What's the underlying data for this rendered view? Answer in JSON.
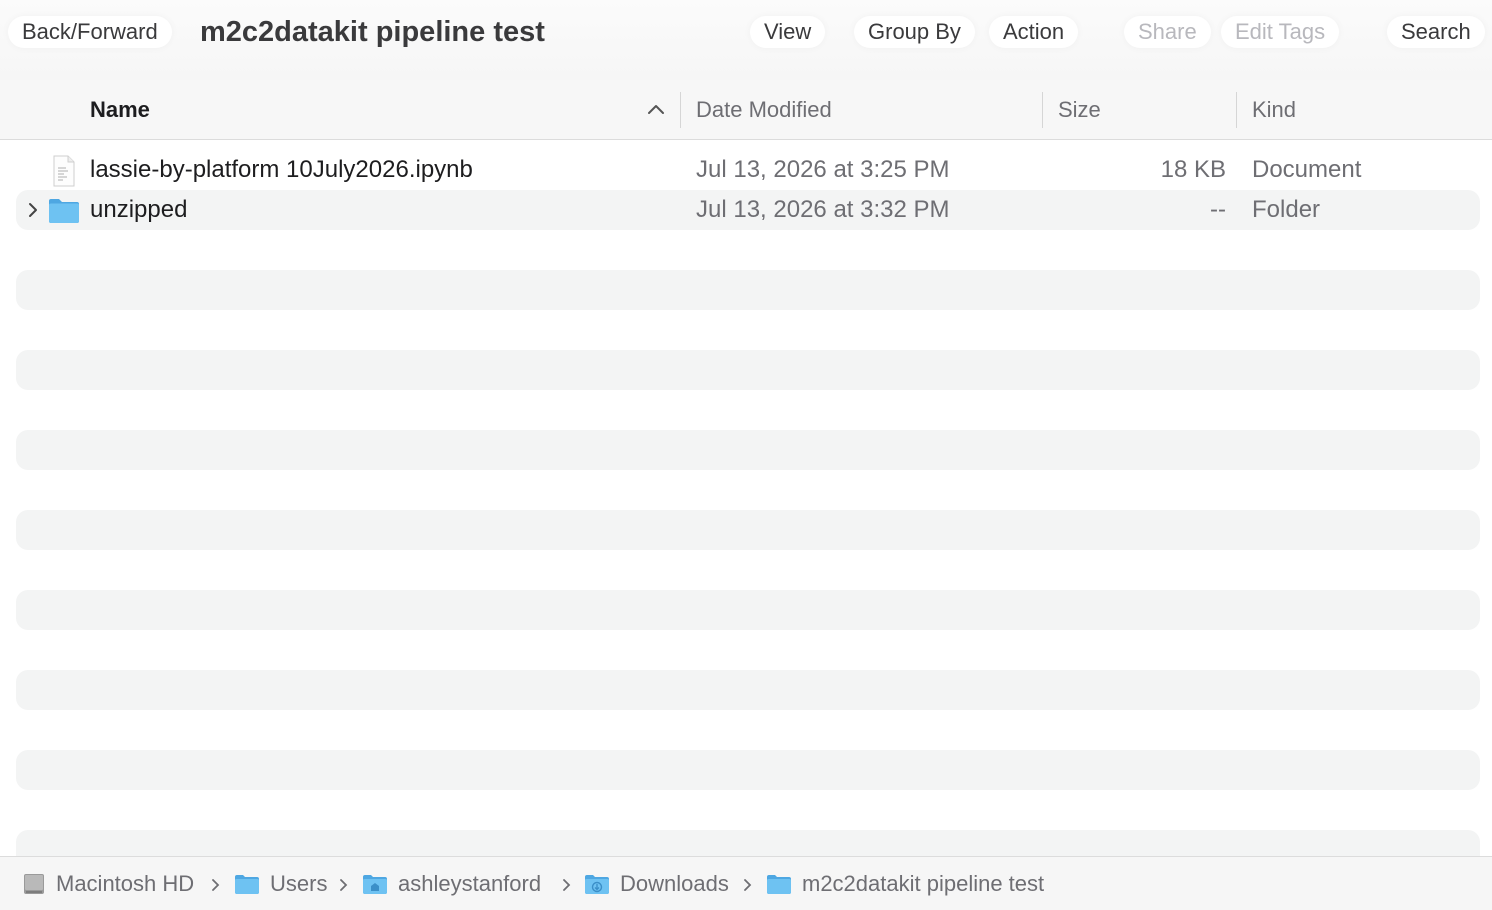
{
  "toolbar": {
    "back_forward": "Back/Forward",
    "title": "m2c2datakit pipeline test",
    "view": "View",
    "group_by": "Group By",
    "action": "Action",
    "share": "Share",
    "edit_tags": "Edit Tags",
    "search": "Search"
  },
  "columns": {
    "name": "Name",
    "date_modified": "Date Modified",
    "size": "Size",
    "kind": "Kind"
  },
  "rows": [
    {
      "name": "lassie-by-platform 10July2026.ipynb",
      "date": "Jul 13, 2026 at 3:25 PM",
      "size": "18 KB",
      "kind": "Document",
      "icon": "document-icon"
    },
    {
      "name": "unzipped",
      "date": "Jul 13, 2026 at 3:32 PM",
      "size": "--",
      "kind": "Folder",
      "icon": "folder-icon"
    }
  ],
  "path": [
    {
      "label": "Macintosh HD",
      "icon": "hard-drive-icon"
    },
    {
      "label": "Users",
      "icon": "folder-icon"
    },
    {
      "label": "ashleystanford",
      "icon": "home-folder-icon"
    },
    {
      "label": "Downloads",
      "icon": "downloads-folder-icon"
    },
    {
      "label": "m2c2datakit pipeline test",
      "icon": "folder-icon"
    }
  ],
  "colors": {
    "folder": "#5fb7ec",
    "stripe": "#f3f4f4",
    "secondary_text": "#6e6e73"
  }
}
